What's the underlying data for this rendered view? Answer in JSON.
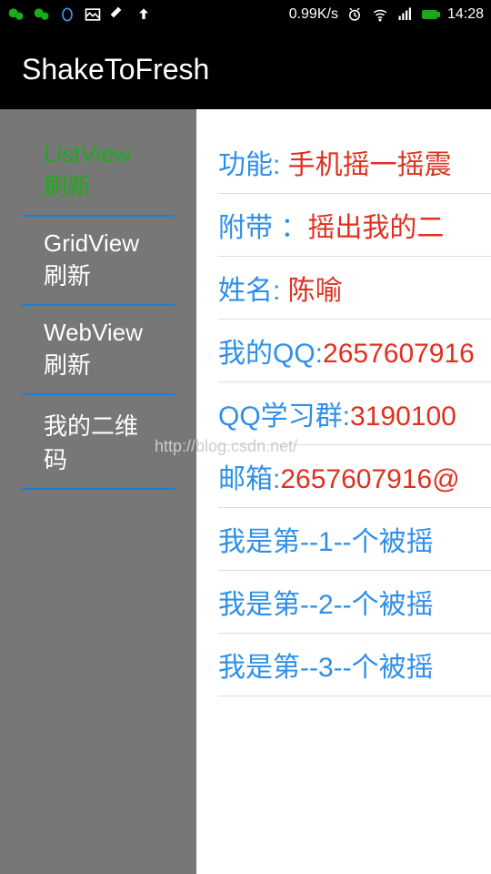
{
  "status_bar": {
    "speed": "0.99K/s",
    "time": "14:28"
  },
  "app_bar": {
    "title": "ShakeToFresh"
  },
  "sidebar": {
    "items": [
      {
        "label": "ListView刷新",
        "active": true
      },
      {
        "label": "GridView刷新",
        "active": false
      },
      {
        "label": "WebView刷新",
        "active": false
      },
      {
        "label": "我的二维码",
        "active": false
      }
    ]
  },
  "content": {
    "rows": [
      {
        "label": "功能: ",
        "value": "手机摇一摇震"
      },
      {
        "label": "附带 ：",
        "value": "摇出我的二"
      },
      {
        "label": "姓名: ",
        "value": "陈喻"
      },
      {
        "label": "我的QQ:",
        "value": "2657607916"
      },
      {
        "label": "QQ学习群:",
        "value": "3190100"
      },
      {
        "label": "邮箱:",
        "value": "2657607916@"
      },
      {
        "label": "我是第--1--个被摇"
      },
      {
        "label": "我是第--2--个被摇"
      },
      {
        "label": "我是第--3--个被摇"
      }
    ]
  },
  "watermark": "http://blog.csdn.net/"
}
